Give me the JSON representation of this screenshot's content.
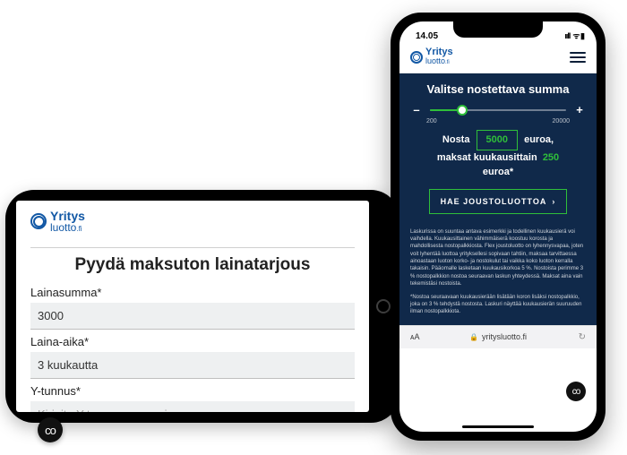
{
  "brand": {
    "line1": "Yritys",
    "line2": "luotto",
    "suffix": ".fi"
  },
  "tablet": {
    "heading": "Pyydä maksuton lainatarjous",
    "fields": {
      "amount_label": "Lainasumma*",
      "amount_value": "3000",
      "term_label": "Laina-aika*",
      "term_value": "3 kuukautta",
      "vat_label": "Y-tunnus*",
      "vat_placeholder": "Kirjoita Y-tunnus numeroina"
    }
  },
  "phone": {
    "status_time": "14.05",
    "hero_title": "Valitse nostettava summa",
    "slider": {
      "min_label": "200",
      "max_label": "20000",
      "minus": "–",
      "plus": "+"
    },
    "line1_a": "Nosta",
    "amount": "5000",
    "line1_b": "euroa,",
    "line2": "maksat kuukausittain",
    "monthly": "250",
    "line3": "euroa*",
    "cta": "HAE JOUSTOLUOTTOA",
    "fine1": "Laskurissa on suuntaa antava esimerkki ja todellinen kuukausierä voi vaihdella. Kuukausittainen vähimmäiserä koostuu korosta ja mahdollisesta nostopalkkiosta. Flex joustoluotto on lyhennysvapaa, joten voit lyhentää luottoa yrityksellesi sopivaan tahtiin, maksaa tarvittaessa ainoastaan luoton korko- ja nostokulut tai vaikka koko luoton kerralla takaisin. Pääomalle lasketaan kuukausikorkoa 5 %. Nostoista perimme 3 % nostopalkkion nostoa seuraavan laskun yhteydessä. Maksat aina vain tekemistäsi nostoista.",
    "fine2": "*Nostoa seuraavaan kuukausierään lisätään koron lisäksi nostopalkkio, joka on 3 % tehdystä nostosta. Laskuri näyttää kuukausierän suuruuden ilman nostopalkkiota.",
    "url": "yritysluotto.fi"
  }
}
